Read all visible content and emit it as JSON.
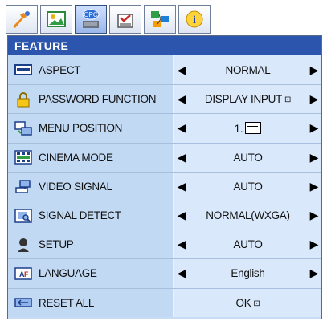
{
  "tabs": [
    {
      "icon": "picture-adjust-icon",
      "active": false
    },
    {
      "icon": "image-icon",
      "active": false
    },
    {
      "icon": "feature-icon",
      "active": true,
      "text": "OPC"
    },
    {
      "icon": "setting-icon",
      "active": false
    },
    {
      "icon": "network-icon",
      "active": false
    },
    {
      "icon": "info-icon",
      "active": false,
      "text": "i"
    }
  ],
  "menu": {
    "title": "FEATURE",
    "items": [
      {
        "label": "ASPECT",
        "icon": "aspect-icon",
        "value": "NORMAL"
      },
      {
        "label": "PASSWORD FUNCTION",
        "icon": "password-icon",
        "value": "DISPLAY INPUT",
        "enter": "⊡"
      },
      {
        "label": "MENU POSITION",
        "icon": "menu-position-icon",
        "value": "1."
      },
      {
        "label": "CINEMA MODE",
        "icon": "cinema-mode-icon",
        "value": "AUTO"
      },
      {
        "label": "VIDEO SIGNAL",
        "icon": "video-signal-icon",
        "value": "AUTO"
      },
      {
        "label": "SIGNAL DETECT",
        "icon": "signal-detect-icon",
        "value": "NORMAL(WXGA)"
      },
      {
        "label": "SETUP",
        "icon": "setup-icon",
        "value": "AUTO"
      },
      {
        "label": "LANGUAGE",
        "icon": "language-icon",
        "value": "English"
      },
      {
        "label": "RESET ALL",
        "icon": "reset-icon",
        "value": "OK",
        "enter": "⊡"
      }
    ],
    "left_arrow": "◀",
    "right_arrow": "▶"
  },
  "colors": {
    "title_bar": "#2c55ae",
    "label_bg": "#c2d9f4",
    "value_bg": "#d9e8fb"
  }
}
